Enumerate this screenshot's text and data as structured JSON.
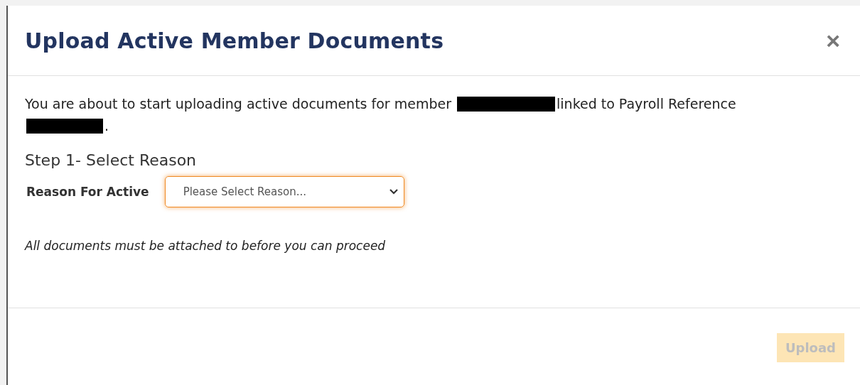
{
  "dialog": {
    "title": "Upload Active Member Documents",
    "close_label": "×"
  },
  "intro": {
    "before": "You are about to start uploading active documents for member",
    "middle": "linked to Payroll Reference",
    "after": "."
  },
  "step_title": "Step 1- Select Reason",
  "reason_field": {
    "label": "Reason For Active",
    "placeholder": "Please Select Reason...",
    "focused": true
  },
  "note": "All documents must be attached to before you can proceed",
  "buttons": [
    {
      "label": "Upload",
      "disabled": true
    }
  ]
}
